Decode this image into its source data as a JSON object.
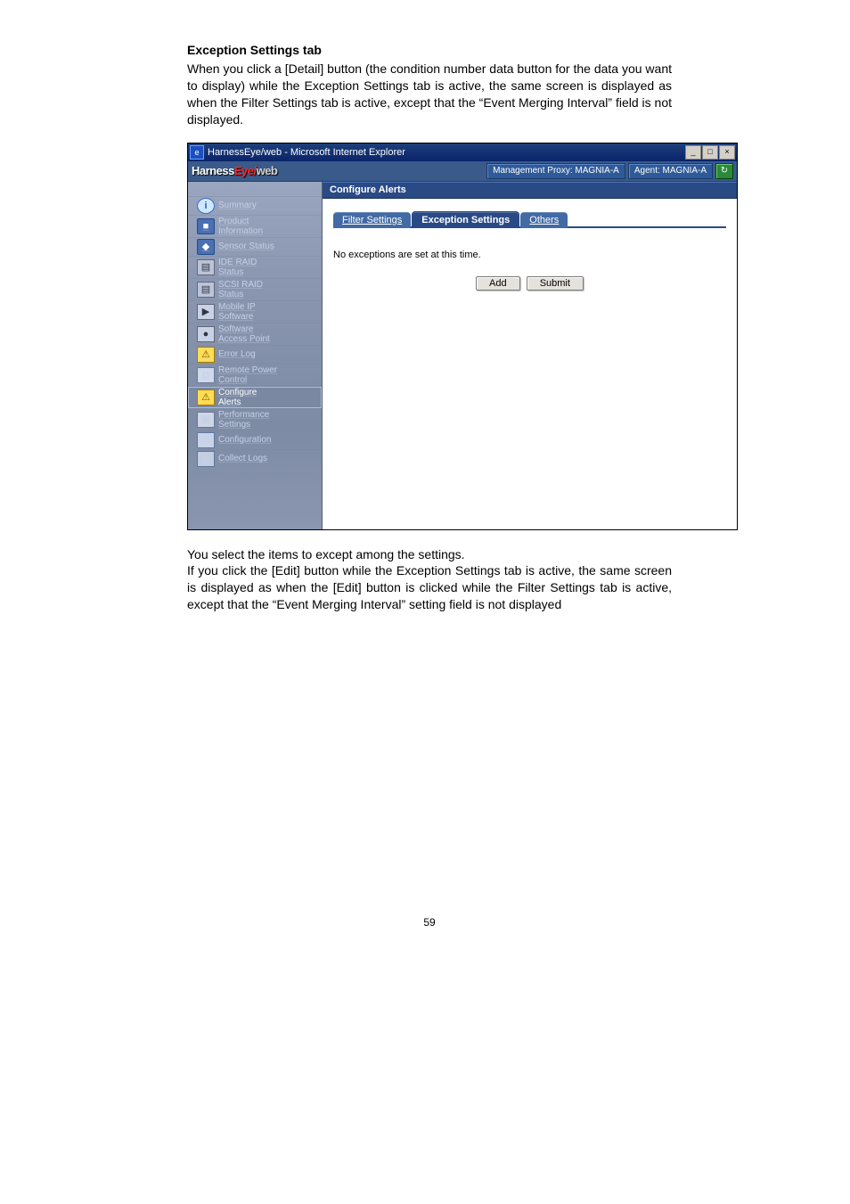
{
  "doc": {
    "heading": "Exception Settings tab",
    "para1": "When you click a [Detail] button (the condition number data button for the data you want to display) while the Exception Settings tab is active, the same screen is displayed as when the Filter Settings tab is active, except that the “Event Merging Interval” field is not displayed.",
    "para2": "You select the items to except among the settings.",
    "para3": "If you click the [Edit] button while the Exception Settings tab is active, the same screen is displayed as when the [Edit] button is clicked while the Filter Settings tab is active, except that the “Event Merging Interval” setting field is not displayed",
    "pagenum": "59"
  },
  "window": {
    "title": "HarnessEye/web - Microsoft Internet Explorer",
    "min": "_",
    "max": "□",
    "close": "×"
  },
  "header": {
    "logo_a": "Harness",
    "logo_b": "Eye",
    "logo_c": "/",
    "logo_d": "web",
    "proxy": "Management Proxy: MAGNIA-A",
    "agent": "Agent: MAGNIA-A"
  },
  "sidebar": [
    {
      "label": "Summary",
      "icon": "i",
      "cls": "ic-info",
      "name": "nav-summary"
    },
    {
      "label": "Product\nInformation",
      "icon": "■",
      "cls": "ic-blue",
      "name": "nav-product-info"
    },
    {
      "label": "Sensor Status",
      "icon": "◆",
      "cls": "ic-blue",
      "name": "nav-sensor-status"
    },
    {
      "label": "IDE RAID\nStatus",
      "icon": "▤",
      "cls": "ic-raid",
      "name": "nav-ide-raid"
    },
    {
      "label": "SCSI RAID\nStatus",
      "icon": "▤",
      "cls": "ic-raid",
      "name": "nav-scsi-raid"
    },
    {
      "label": "Mobile IP\nSoftware",
      "icon": "▶",
      "cls": "ic-hdd",
      "name": "nav-mobile-ip"
    },
    {
      "label": "Software\nAccess Point",
      "icon": "●",
      "cls": "ic-hdd",
      "name": "nav-sw-ap"
    },
    {
      "label": "Error Log",
      "icon": "⚠",
      "cls": "ic-warn",
      "name": "nav-error-log"
    },
    {
      "label": "Remote Power\nControl",
      "icon": "◘",
      "cls": "ic-pwr",
      "name": "nav-remote-power"
    },
    {
      "label": "Configure\nAlerts",
      "icon": "⚠",
      "cls": "ic-warn",
      "name": "nav-configure-alerts",
      "selected": true
    },
    {
      "label": "Performance\nSettings",
      "icon": "▣",
      "cls": "ic-perf",
      "name": "nav-performance"
    },
    {
      "label": "Configuration",
      "icon": "⚙",
      "cls": "ic-cfg",
      "name": "nav-configuration"
    },
    {
      "label": "Collect Logs",
      "icon": "▥",
      "cls": "ic-col",
      "name": "nav-collect-logs"
    }
  ],
  "content": {
    "section": "Configure Alerts",
    "tabs": {
      "filter": "Filter Settings",
      "exception": "Exception Settings",
      "others": "Others"
    },
    "empty_msg": "No exceptions are set at this time.",
    "add_btn": "Add",
    "submit_btn": "Submit"
  }
}
